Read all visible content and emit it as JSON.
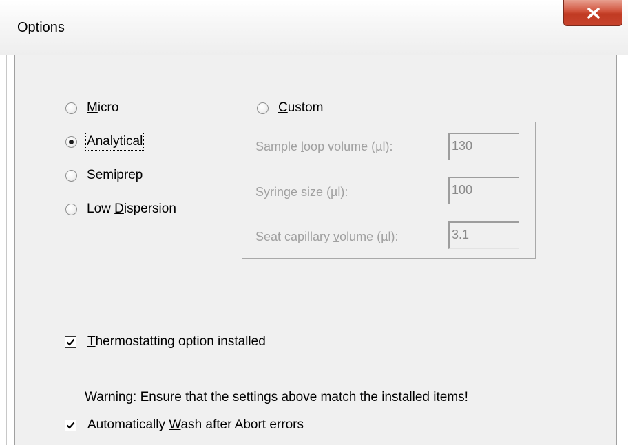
{
  "window": {
    "title": "Options",
    "close_glyph": "x"
  },
  "modes": [
    {
      "prefix": "",
      "key": "M",
      "suffix": "icro",
      "checked": false
    },
    {
      "prefix": "",
      "key": "A",
      "suffix": "nalytical",
      "checked": true
    },
    {
      "prefix": "",
      "key": "S",
      "suffix": "emiprep",
      "checked": false
    },
    {
      "prefix": "Low ",
      "key": "D",
      "suffix": "ispersion",
      "checked": false
    }
  ],
  "custom": {
    "radio": {
      "prefix": "",
      "key": "C",
      "suffix": "ustom",
      "checked": false
    },
    "fields": [
      {
        "label_prefix": "Sample ",
        "label_key": "l",
        "label_suffix": "oop volume (µl):",
        "value": "130"
      },
      {
        "label_prefix": "S",
        "label_key": "y",
        "label_suffix": "ringe size (µl):",
        "value": "100"
      },
      {
        "label_prefix": "Seat capillary ",
        "label_key": "v",
        "label_suffix": "olume (µl):",
        "value": "3.1"
      }
    ]
  },
  "thermostat": {
    "prefix": "",
    "key": "T",
    "suffix": "hermostatting option installed",
    "checked": true
  },
  "warning": "Warning: Ensure that the settings above match the installed items!",
  "autowash": {
    "prefix": "Automatically ",
    "key": "W",
    "suffix": "ash after Abort errors",
    "checked": true
  }
}
